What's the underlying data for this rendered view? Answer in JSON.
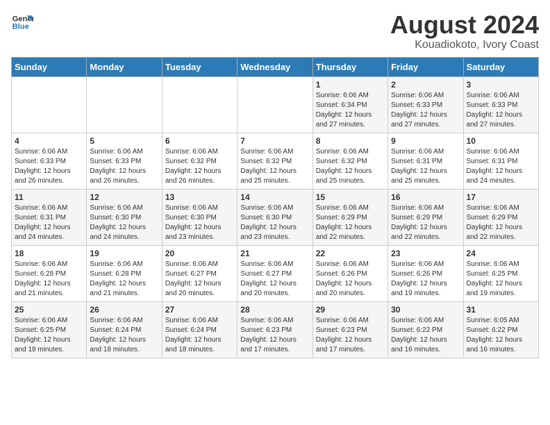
{
  "header": {
    "logo_line1": "General",
    "logo_line2": "Blue",
    "title": "August 2024",
    "subtitle": "Kouadiokoto, Ivory Coast"
  },
  "days_of_week": [
    "Sunday",
    "Monday",
    "Tuesday",
    "Wednesday",
    "Thursday",
    "Friday",
    "Saturday"
  ],
  "weeks": [
    [
      {
        "day": "",
        "info": ""
      },
      {
        "day": "",
        "info": ""
      },
      {
        "day": "",
        "info": ""
      },
      {
        "day": "",
        "info": ""
      },
      {
        "day": "1",
        "info": "Sunrise: 6:06 AM\nSunset: 6:34 PM\nDaylight: 12 hours\nand 27 minutes."
      },
      {
        "day": "2",
        "info": "Sunrise: 6:06 AM\nSunset: 6:33 PM\nDaylight: 12 hours\nand 27 minutes."
      },
      {
        "day": "3",
        "info": "Sunrise: 6:06 AM\nSunset: 6:33 PM\nDaylight: 12 hours\nand 27 minutes."
      }
    ],
    [
      {
        "day": "4",
        "info": "Sunrise: 6:06 AM\nSunset: 6:33 PM\nDaylight: 12 hours\nand 26 minutes."
      },
      {
        "day": "5",
        "info": "Sunrise: 6:06 AM\nSunset: 6:33 PM\nDaylight: 12 hours\nand 26 minutes."
      },
      {
        "day": "6",
        "info": "Sunrise: 6:06 AM\nSunset: 6:32 PM\nDaylight: 12 hours\nand 26 minutes."
      },
      {
        "day": "7",
        "info": "Sunrise: 6:06 AM\nSunset: 6:32 PM\nDaylight: 12 hours\nand 25 minutes."
      },
      {
        "day": "8",
        "info": "Sunrise: 6:06 AM\nSunset: 6:32 PM\nDaylight: 12 hours\nand 25 minutes."
      },
      {
        "day": "9",
        "info": "Sunrise: 6:06 AM\nSunset: 6:31 PM\nDaylight: 12 hours\nand 25 minutes."
      },
      {
        "day": "10",
        "info": "Sunrise: 6:06 AM\nSunset: 6:31 PM\nDaylight: 12 hours\nand 24 minutes."
      }
    ],
    [
      {
        "day": "11",
        "info": "Sunrise: 6:06 AM\nSunset: 6:31 PM\nDaylight: 12 hours\nand 24 minutes."
      },
      {
        "day": "12",
        "info": "Sunrise: 6:06 AM\nSunset: 6:30 PM\nDaylight: 12 hours\nand 24 minutes."
      },
      {
        "day": "13",
        "info": "Sunrise: 6:06 AM\nSunset: 6:30 PM\nDaylight: 12 hours\nand 23 minutes."
      },
      {
        "day": "14",
        "info": "Sunrise: 6:06 AM\nSunset: 6:30 PM\nDaylight: 12 hours\nand 23 minutes."
      },
      {
        "day": "15",
        "info": "Sunrise: 6:06 AM\nSunset: 6:29 PM\nDaylight: 12 hours\nand 22 minutes."
      },
      {
        "day": "16",
        "info": "Sunrise: 6:06 AM\nSunset: 6:29 PM\nDaylight: 12 hours\nand 22 minutes."
      },
      {
        "day": "17",
        "info": "Sunrise: 6:06 AM\nSunset: 6:29 PM\nDaylight: 12 hours\nand 22 minutes."
      }
    ],
    [
      {
        "day": "18",
        "info": "Sunrise: 6:06 AM\nSunset: 6:28 PM\nDaylight: 12 hours\nand 21 minutes."
      },
      {
        "day": "19",
        "info": "Sunrise: 6:06 AM\nSunset: 6:28 PM\nDaylight: 12 hours\nand 21 minutes."
      },
      {
        "day": "20",
        "info": "Sunrise: 6:06 AM\nSunset: 6:27 PM\nDaylight: 12 hours\nand 20 minutes."
      },
      {
        "day": "21",
        "info": "Sunrise: 6:06 AM\nSunset: 6:27 PM\nDaylight: 12 hours\nand 20 minutes."
      },
      {
        "day": "22",
        "info": "Sunrise: 6:06 AM\nSunset: 6:26 PM\nDaylight: 12 hours\nand 20 minutes."
      },
      {
        "day": "23",
        "info": "Sunrise: 6:06 AM\nSunset: 6:26 PM\nDaylight: 12 hours\nand 19 minutes."
      },
      {
        "day": "24",
        "info": "Sunrise: 6:06 AM\nSunset: 6:25 PM\nDaylight: 12 hours\nand 19 minutes."
      }
    ],
    [
      {
        "day": "25",
        "info": "Sunrise: 6:06 AM\nSunset: 6:25 PM\nDaylight: 12 hours\nand 18 minutes."
      },
      {
        "day": "26",
        "info": "Sunrise: 6:06 AM\nSunset: 6:24 PM\nDaylight: 12 hours\nand 18 minutes."
      },
      {
        "day": "27",
        "info": "Sunrise: 6:06 AM\nSunset: 6:24 PM\nDaylight: 12 hours\nand 18 minutes."
      },
      {
        "day": "28",
        "info": "Sunrise: 6:06 AM\nSunset: 6:23 PM\nDaylight: 12 hours\nand 17 minutes."
      },
      {
        "day": "29",
        "info": "Sunrise: 6:06 AM\nSunset: 6:23 PM\nDaylight: 12 hours\nand 17 minutes."
      },
      {
        "day": "30",
        "info": "Sunrise: 6:06 AM\nSunset: 6:22 PM\nDaylight: 12 hours\nand 16 minutes."
      },
      {
        "day": "31",
        "info": "Sunrise: 6:05 AM\nSunset: 6:22 PM\nDaylight: 12 hours\nand 16 minutes."
      }
    ]
  ]
}
